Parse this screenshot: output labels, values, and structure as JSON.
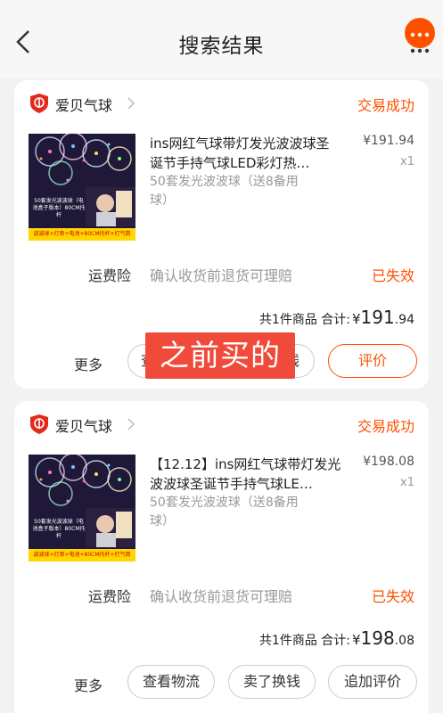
{
  "header": {
    "title": "搜索结果"
  },
  "orders": [
    {
      "shop_name": "爱贝气球",
      "status": "交易成功",
      "product": {
        "title": "ins网红气球带灯发光波波球圣诞节手持气球LED彩灯热…",
        "variant": "50套发光波波球（送8备用球）",
        "price": "¥191.94",
        "qty": "x1",
        "image_caption": "50套发光波波球（电池盒子版本）80CM托杆",
        "image_tag": "波波球+灯串+电池+80CM托杆+打气筒"
      },
      "insurance": {
        "label": "运费险",
        "desc": "确认收货前退货可理赔",
        "status": "已失效"
      },
      "summary": {
        "prefix": "共1件商品 合计:",
        "currency": "¥",
        "amount": "191",
        "cents": ".94"
      },
      "actions": {
        "more": "更多",
        "btn1": "查看物流",
        "btn2": "卖了换钱",
        "btn3": "评价"
      }
    },
    {
      "shop_name": "爱贝气球",
      "status": "交易成功",
      "product": {
        "title": "【12.12】ins网红气球带灯发光波波球圣诞节手持气球LE…",
        "variant": "50套发光波波球（送8备用球）",
        "price": "¥198.08",
        "qty": "x1",
        "image_caption": "50套发光波波球（电池盒子版本）80CM托杆",
        "image_tag": "波波球+灯串+电池+80CM托杆+打气筒"
      },
      "insurance": {
        "label": "运费险",
        "desc": "确认收货前退货可理赔",
        "status": "已失效"
      },
      "summary": {
        "prefix": "共1件商品 合计:",
        "currency": "¥",
        "amount": "198",
        "cents": ".08"
      },
      "actions": {
        "more": "更多",
        "btn1": "查看物流",
        "btn2": "卖了换钱",
        "btn3": "追加评价"
      }
    }
  ],
  "overlay_text": "之前买的",
  "colors": {
    "accent": "#ff5000",
    "overlay": "#f04a3a",
    "muted": "#999999"
  }
}
